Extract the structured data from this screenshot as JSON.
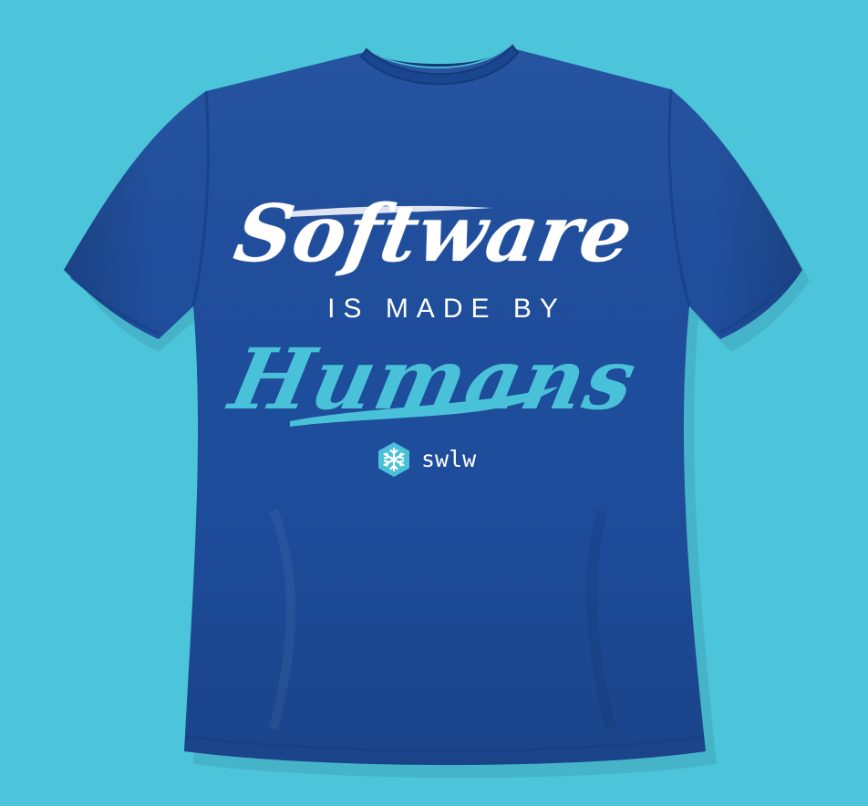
{
  "scene": {
    "background_color": "#4cc4da",
    "garment": "t-shirt",
    "garment_color": "#1e4d9c"
  },
  "print": {
    "headline": "Software",
    "subline": "IS MADE BY",
    "accent_word": "Humans",
    "text_color": "#ffffff",
    "accent_color": "#49c1d8"
  },
  "brand": {
    "icon": "snowflake-icon",
    "name": "swlw"
  }
}
